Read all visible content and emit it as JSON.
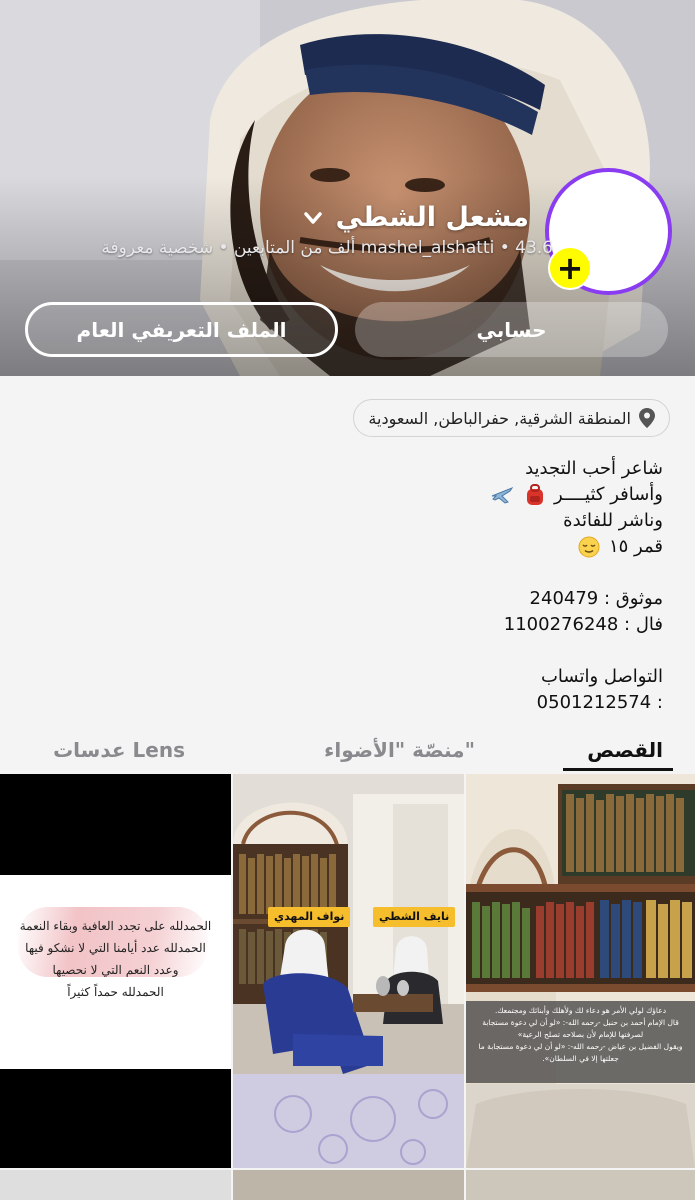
{
  "profile": {
    "display_name": "مشعل الشطي",
    "subtitle": "mashel_alshatti • 43.6 ألف من المتابعين • شخصية معروفة",
    "add_symbol": "+"
  },
  "buttons": {
    "my_account": "حسابي",
    "public_profile": "الملف التعريفي العام"
  },
  "location": "المنطقة الشرقية, حفرالباطن, السعودية",
  "bio": {
    "line1": "شاعر أحب التجديد",
    "line2": "وأسافر كثيــــر",
    "line3": "وناشر للفائدة",
    "line4": "قمر ١٥",
    "trusted": "موثوق : 240479",
    "fal": "فال : 1100276248",
    "contact_title": "التواصل واتساب",
    "contact_number": ": 0501212574"
  },
  "tabs": {
    "stories": "القصص",
    "spotlight": "منصّة \"الأضواء\"",
    "lenses": "عدسات Lens"
  },
  "tiles": {
    "caption": [
      "دعاؤك لولي الأمر هو دعاء لك ولأهلك وأبنائك ومجتمعك.",
      "قال الإمام أحمد بن حنبل -رحمه الله-: «لو أن لي دعوة مستجابة",
      "لصرفتها للإمام لأن بصلاحه تصلح الرعية»",
      "ويقول الفضيل بن عياض -رحمه الله-: «لو أن لي دعوة مستجابة ما",
      "جعلتها إلا في السلطان»."
    ],
    "tag_left": "نواف المهدي",
    "tag_right": "نايف الشطي",
    "quote": [
      "الحمدلله على تجدد العافية وبقاء النعمة",
      "الحمدلله عدد أيامنا التي لا نشكو فيها",
      "وعدد النعم التي لا نحصيها",
      "الحمدلله حمداً كثيراً"
    ]
  },
  "colors": {
    "accent_yellow": "#fffc00",
    "ring_purple": "#8a3cf0",
    "tag_orange": "#f6bd2c"
  },
  "icons": {
    "location": "location-pin-icon",
    "chevron": "chevron-down-icon",
    "add": "plus-icon"
  }
}
